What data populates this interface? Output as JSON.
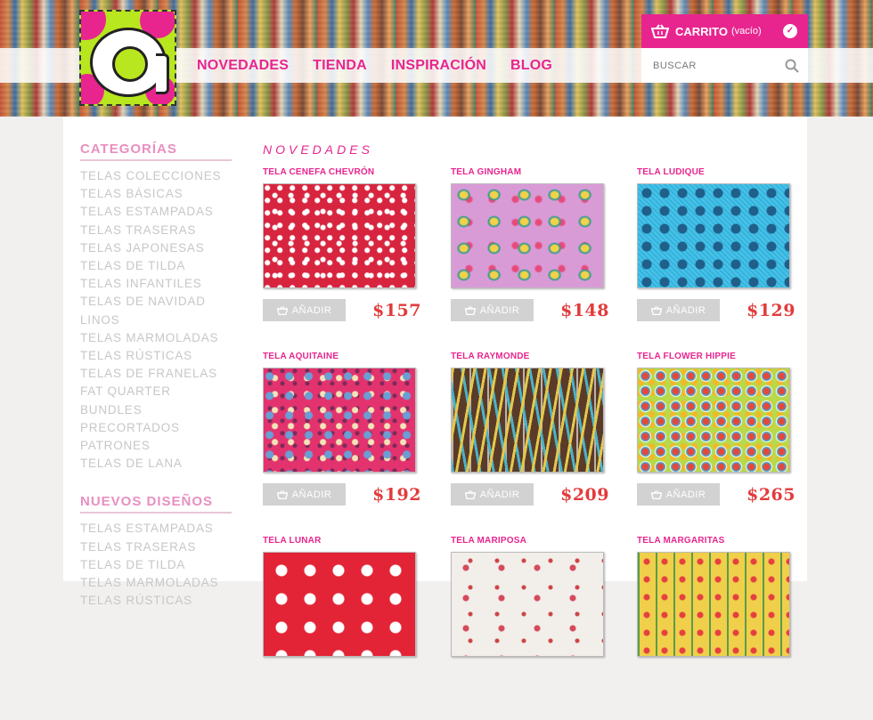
{
  "header": {
    "nav": [
      {
        "label": "NOVEDADES"
      },
      {
        "label": "TIENDA"
      },
      {
        "label": "INSPIRACIÓN"
      },
      {
        "label": "BLOG"
      }
    ],
    "cart": {
      "title": "CARRITO",
      "status": "(vacío)"
    },
    "search": {
      "placeholder": "BUSCAR"
    }
  },
  "sidebar": {
    "categories_title": "CATEGORÍAS",
    "categories": [
      "TELAS COLECCIONES",
      "TELAS BÁSICAS",
      "TELAS ESTAMPADAS",
      "TELAS TRASERAS",
      "TELAS JAPONESAS",
      "TELAS DE TILDA",
      "TELAS INFANTILES",
      "TELAS DE NAVIDAD",
      "LINOS",
      "TELAS MARMOLADAS",
      "TELAS RÚSTICAS",
      "TELAS DE FRANELAS",
      "FAT QUARTER BUNDLES",
      "PRECORTADOS",
      "PATRONES",
      "TELAS DE LANA"
    ],
    "new_designs_title": "NUEVOS DISEÑOS",
    "new_designs": [
      "TELAS ESTAMPADAS",
      "TELAS TRASERAS",
      "TELAS DE TILDA",
      "TELAS MARMOLADAS",
      "TELAS RÚSTICAS"
    ]
  },
  "main": {
    "section_title": "NOVEDADES",
    "add_label": "AÑADIR",
    "products": [
      {
        "name": "TELA CENEFA CHEVRÓN",
        "price": "$157"
      },
      {
        "name": "TELA GINGHAM",
        "price": "$148"
      },
      {
        "name": "TELA LUDIQUE",
        "price": "$129"
      },
      {
        "name": "TELA AQUITAINE",
        "price": "$192"
      },
      {
        "name": "TELA RAYMONDE",
        "price": "$209"
      },
      {
        "name": "TELA FLOWER HIPPIE",
        "price": "$265"
      },
      {
        "name": "TELA LUNAR",
        "price": ""
      },
      {
        "name": "TELA MARIPOSA",
        "price": ""
      },
      {
        "name": "TELA MARGARITAS",
        "price": ""
      }
    ]
  },
  "colors": {
    "brand_pink": "#e8258f",
    "price_red": "#e33b3b",
    "logo_green": "#b8e61f"
  }
}
